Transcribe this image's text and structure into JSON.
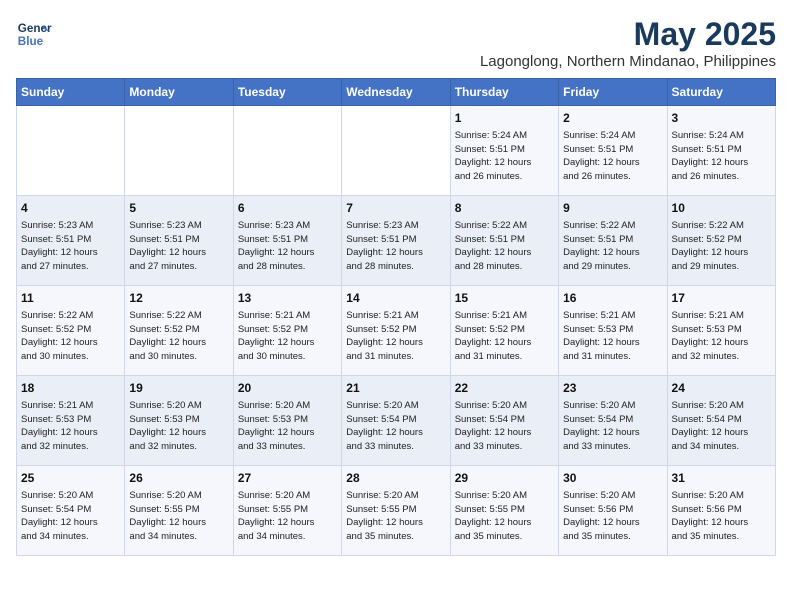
{
  "header": {
    "logo_line1": "General",
    "logo_line2": "Blue",
    "title": "May 2025",
    "subtitle": "Lagonglong, Northern Mindanao, Philippines"
  },
  "days_of_week": [
    "Sunday",
    "Monday",
    "Tuesday",
    "Wednesday",
    "Thursday",
    "Friday",
    "Saturday"
  ],
  "weeks": [
    [
      {
        "num": "",
        "info": ""
      },
      {
        "num": "",
        "info": ""
      },
      {
        "num": "",
        "info": ""
      },
      {
        "num": "",
        "info": ""
      },
      {
        "num": "1",
        "info": "Sunrise: 5:24 AM\nSunset: 5:51 PM\nDaylight: 12 hours\nand 26 minutes."
      },
      {
        "num": "2",
        "info": "Sunrise: 5:24 AM\nSunset: 5:51 PM\nDaylight: 12 hours\nand 26 minutes."
      },
      {
        "num": "3",
        "info": "Sunrise: 5:24 AM\nSunset: 5:51 PM\nDaylight: 12 hours\nand 26 minutes."
      }
    ],
    [
      {
        "num": "4",
        "info": "Sunrise: 5:23 AM\nSunset: 5:51 PM\nDaylight: 12 hours\nand 27 minutes."
      },
      {
        "num": "5",
        "info": "Sunrise: 5:23 AM\nSunset: 5:51 PM\nDaylight: 12 hours\nand 27 minutes."
      },
      {
        "num": "6",
        "info": "Sunrise: 5:23 AM\nSunset: 5:51 PM\nDaylight: 12 hours\nand 28 minutes."
      },
      {
        "num": "7",
        "info": "Sunrise: 5:23 AM\nSunset: 5:51 PM\nDaylight: 12 hours\nand 28 minutes."
      },
      {
        "num": "8",
        "info": "Sunrise: 5:22 AM\nSunset: 5:51 PM\nDaylight: 12 hours\nand 28 minutes."
      },
      {
        "num": "9",
        "info": "Sunrise: 5:22 AM\nSunset: 5:51 PM\nDaylight: 12 hours\nand 29 minutes."
      },
      {
        "num": "10",
        "info": "Sunrise: 5:22 AM\nSunset: 5:52 PM\nDaylight: 12 hours\nand 29 minutes."
      }
    ],
    [
      {
        "num": "11",
        "info": "Sunrise: 5:22 AM\nSunset: 5:52 PM\nDaylight: 12 hours\nand 30 minutes."
      },
      {
        "num": "12",
        "info": "Sunrise: 5:22 AM\nSunset: 5:52 PM\nDaylight: 12 hours\nand 30 minutes."
      },
      {
        "num": "13",
        "info": "Sunrise: 5:21 AM\nSunset: 5:52 PM\nDaylight: 12 hours\nand 30 minutes."
      },
      {
        "num": "14",
        "info": "Sunrise: 5:21 AM\nSunset: 5:52 PM\nDaylight: 12 hours\nand 31 minutes."
      },
      {
        "num": "15",
        "info": "Sunrise: 5:21 AM\nSunset: 5:52 PM\nDaylight: 12 hours\nand 31 minutes."
      },
      {
        "num": "16",
        "info": "Sunrise: 5:21 AM\nSunset: 5:53 PM\nDaylight: 12 hours\nand 31 minutes."
      },
      {
        "num": "17",
        "info": "Sunrise: 5:21 AM\nSunset: 5:53 PM\nDaylight: 12 hours\nand 32 minutes."
      }
    ],
    [
      {
        "num": "18",
        "info": "Sunrise: 5:21 AM\nSunset: 5:53 PM\nDaylight: 12 hours\nand 32 minutes."
      },
      {
        "num": "19",
        "info": "Sunrise: 5:20 AM\nSunset: 5:53 PM\nDaylight: 12 hours\nand 32 minutes."
      },
      {
        "num": "20",
        "info": "Sunrise: 5:20 AM\nSunset: 5:53 PM\nDaylight: 12 hours\nand 33 minutes."
      },
      {
        "num": "21",
        "info": "Sunrise: 5:20 AM\nSunset: 5:54 PM\nDaylight: 12 hours\nand 33 minutes."
      },
      {
        "num": "22",
        "info": "Sunrise: 5:20 AM\nSunset: 5:54 PM\nDaylight: 12 hours\nand 33 minutes."
      },
      {
        "num": "23",
        "info": "Sunrise: 5:20 AM\nSunset: 5:54 PM\nDaylight: 12 hours\nand 33 minutes."
      },
      {
        "num": "24",
        "info": "Sunrise: 5:20 AM\nSunset: 5:54 PM\nDaylight: 12 hours\nand 34 minutes."
      }
    ],
    [
      {
        "num": "25",
        "info": "Sunrise: 5:20 AM\nSunset: 5:54 PM\nDaylight: 12 hours\nand 34 minutes."
      },
      {
        "num": "26",
        "info": "Sunrise: 5:20 AM\nSunset: 5:55 PM\nDaylight: 12 hours\nand 34 minutes."
      },
      {
        "num": "27",
        "info": "Sunrise: 5:20 AM\nSunset: 5:55 PM\nDaylight: 12 hours\nand 34 minutes."
      },
      {
        "num": "28",
        "info": "Sunrise: 5:20 AM\nSunset: 5:55 PM\nDaylight: 12 hours\nand 35 minutes."
      },
      {
        "num": "29",
        "info": "Sunrise: 5:20 AM\nSunset: 5:55 PM\nDaylight: 12 hours\nand 35 minutes."
      },
      {
        "num": "30",
        "info": "Sunrise: 5:20 AM\nSunset: 5:56 PM\nDaylight: 12 hours\nand 35 minutes."
      },
      {
        "num": "31",
        "info": "Sunrise: 5:20 AM\nSunset: 5:56 PM\nDaylight: 12 hours\nand 35 minutes."
      }
    ]
  ]
}
